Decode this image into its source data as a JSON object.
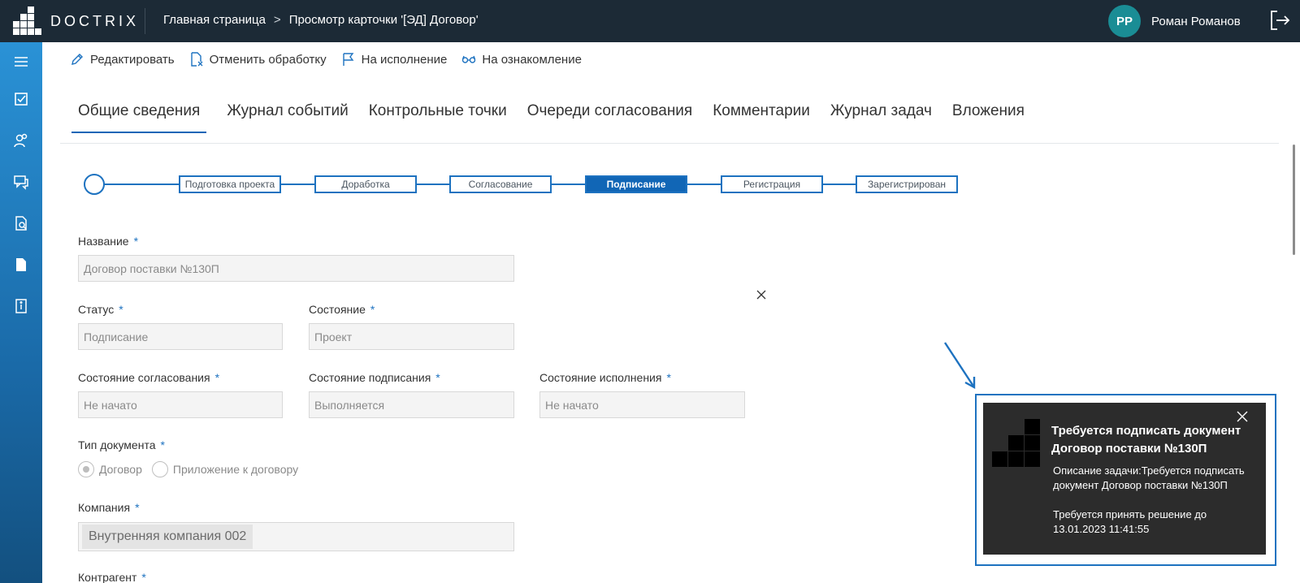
{
  "app": {
    "logo_text": "DOCTRIX"
  },
  "breadcrumb": {
    "home": "Главная страница",
    "separator": ">",
    "current": "Просмотр карточки '[ЭД] Договор'"
  },
  "user": {
    "initials": "РР",
    "name": "Роман Романов"
  },
  "sidebar": {
    "items": [
      {
        "icon": "menu-icon"
      },
      {
        "icon": "tasks-icon"
      },
      {
        "icon": "users-icon"
      },
      {
        "icon": "chat-icon"
      },
      {
        "icon": "document-search-icon"
      },
      {
        "icon": "document-icon"
      },
      {
        "icon": "info-book-icon"
      }
    ]
  },
  "toolbar": {
    "edit": "Редактировать",
    "cancel_processing": "Отменить обработку",
    "to_execution": "На исполнение",
    "to_review": "На ознакомление"
  },
  "tabs": [
    {
      "label": "Общие сведения",
      "active": true
    },
    {
      "label": "Журнал событий"
    },
    {
      "label": "Контрольные точки"
    },
    {
      "label": "Очереди согласования"
    },
    {
      "label": "Комментарии"
    },
    {
      "label": "Журнал задач"
    },
    {
      "label": "Вложения"
    }
  ],
  "stepper": {
    "steps": [
      {
        "label": "Подготовка проекта"
      },
      {
        "label": "Доработка"
      },
      {
        "label": "Согласование"
      },
      {
        "label": "Подписание",
        "active": true
      },
      {
        "label": "Регистрация"
      },
      {
        "label": "Зарегистрирован"
      }
    ]
  },
  "form": {
    "name": {
      "label": "Название",
      "value": "Договор поставки №130П"
    },
    "status": {
      "label": "Статус",
      "value": "Подписание"
    },
    "state": {
      "label": "Состояние",
      "value": "Проект"
    },
    "approval_state": {
      "label": "Состояние согласования",
      "value": "Не начато"
    },
    "signing_state": {
      "label": "Состояние подписания",
      "value": "Выполняется"
    },
    "execution_state": {
      "label": "Состояние исполнения",
      "value": "Не начато"
    },
    "doc_type": {
      "label": "Тип документа",
      "options": [
        "Договор",
        "Приложение к договору"
      ],
      "selected": "Договор"
    },
    "company": {
      "label": "Компания",
      "value": "Внутренняя компания 002"
    },
    "counterparty": {
      "label": "Контрагент"
    },
    "required_mark": "*"
  },
  "notification": {
    "title_line1": "Требуется подписать документ",
    "title_line2": "Договор поставки №130П",
    "description": "Описание задачи:Требуется подписать документ Договор поставки №130П",
    "deadline": "Требуется принять решение до 13.01.2023 11:41:55"
  },
  "colors": {
    "topbar": "#1c2a36",
    "accent": "#1166b6",
    "avatar": "#1a8d95",
    "notification_bg": "#2c2c2c"
  }
}
